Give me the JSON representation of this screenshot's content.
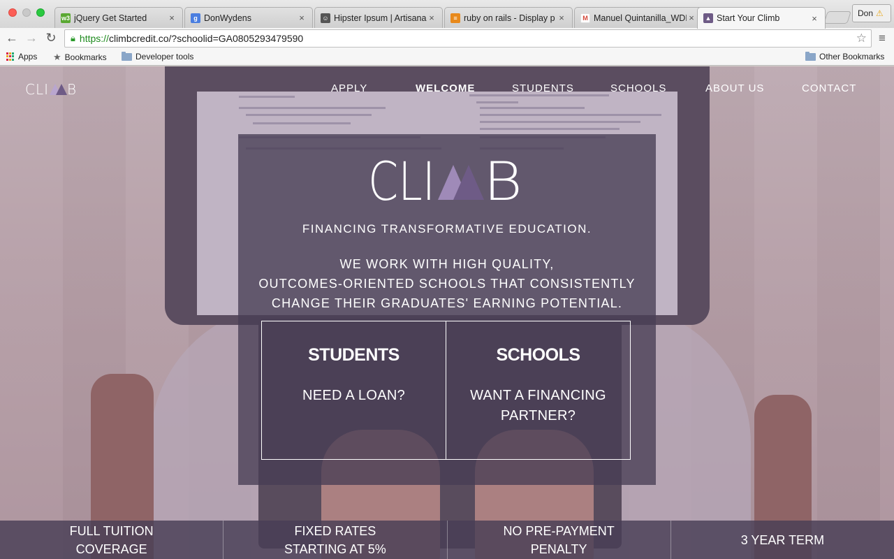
{
  "browser": {
    "tabs": [
      {
        "label": "jQuery Get Started",
        "icon": "w3schools-icon",
        "color": "#5aa832"
      },
      {
        "label": "DonWydens",
        "icon": "google-plus-icon",
        "color": "#4a7ee0"
      },
      {
        "label": "Hipster Ipsum | Artisanal",
        "icon": "hipster-icon",
        "color": "#555555"
      },
      {
        "label": "ruby on rails - Display p",
        "icon": "stackoverflow-icon",
        "color": "#e8891b"
      },
      {
        "label": "Manuel Quintanilla_WDI",
        "icon": "gmail-icon",
        "color": "#d44638"
      },
      {
        "label": "Start Your Climb",
        "icon": "climb-icon",
        "color": "#6e5b86"
      }
    ],
    "profile": "Don",
    "url_protocol": "https://",
    "url_rest": "climbcredit.co/?schoolid=GA0805293479590",
    "bookmarks": {
      "apps": "Apps",
      "bookmarks": "Bookmarks",
      "developer_tools": "Developer tools",
      "other": "Other Bookmarks"
    }
  },
  "site": {
    "nav": {
      "apply": "APPLY",
      "welcome": "WELCOME",
      "students": "STUDENTS",
      "schools": "SCHOOLS",
      "about": "ABOUT US",
      "contact": "CONTACT"
    },
    "hero": {
      "tagline": "FINANCING TRANSFORMATIVE EDUCATION.",
      "mission_1": "WE WORK WITH HIGH QUALITY,",
      "mission_2": "OUTCOMES-ORIENTED SCHOOLS THAT CONSISTENTLY",
      "mission_3": "CHANGE THEIR GRADUATES' EARNING POTENTIAL."
    },
    "cards": {
      "students_title": "STUDENTS",
      "students_sub": "NEED A LOAN?",
      "schools_title": "SCHOOLS",
      "schools_sub_1": "WANT A FINANCING",
      "schools_sub_2": "PARTNER?"
    },
    "features": [
      {
        "line1": "FULL TUITION",
        "line2": "COVERAGE"
      },
      {
        "line1": "FIXED RATES",
        "line2": "STARTING AT 5%"
      },
      {
        "line1": "NO PRE-PAYMENT",
        "line2": "PENALTY"
      },
      {
        "line1": "3 YEAR TERM",
        "line2": ""
      }
    ],
    "colors": {
      "brand_purple": "#6e5b86",
      "panel": "#483e55"
    }
  }
}
